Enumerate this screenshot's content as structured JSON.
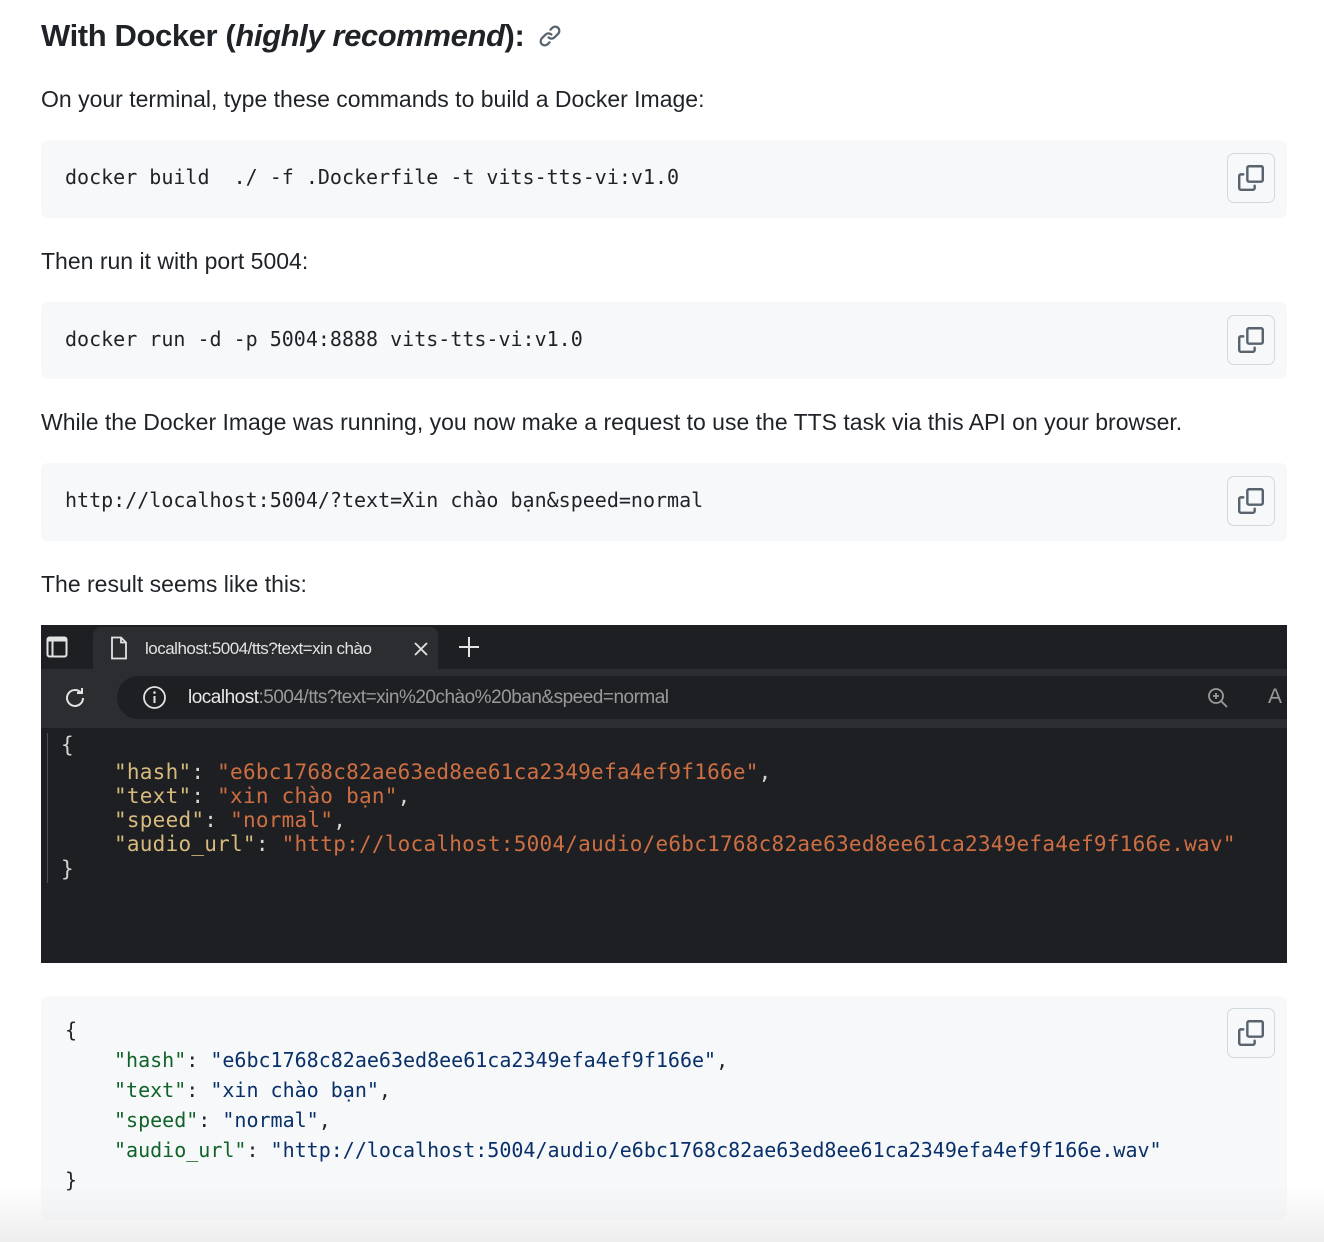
{
  "heading": {
    "prefix": "With Docker (",
    "emphasis": "highly recommend",
    "suffix": "):"
  },
  "para_build": "On your terminal, type these commands to build a Docker Image:",
  "code_build": "docker build  ./ -f .Dockerfile -t vits-tts-vi:v1.0",
  "para_run": "Then run it with port 5004:",
  "code_run": "docker run -d -p 5004:8888 vits-tts-vi:v1.0",
  "para_api": "While the Docker Image was running, you now make a request to use the TTS task via this API on your browser.",
  "code_api": "http://localhost:5004/?text=Xin chào bạn&speed=normal",
  "para_result": "The result seems like this:",
  "screenshot": {
    "tab_title": "localhost:5004/tts?text=xin chào",
    "address_host": "localhost",
    "address_rest": ":5004/tts?text=xin%20chào%20ban&speed=normal",
    "json": {
      "open": "{",
      "close": "}",
      "hash_key": "\"hash\"",
      "hash_val": "\"e6bc1768c82ae63ed8ee61ca2349efa4ef9f166e\"",
      "text_key": "\"text\"",
      "text_val": "\"xin chào bạn\"",
      "speed_key": "\"speed\"",
      "speed_val": "\"normal\"",
      "audio_key": "\"audio_url\"",
      "audio_val": "\"http://localhost:5004/audio/e6bc1768c82ae63ed8ee61ca2349efa4ef9f166e.wav\""
    }
  },
  "result_json": {
    "open": "{",
    "close": "}",
    "hash_key": "\"hash\"",
    "hash_val": "\"e6bc1768c82ae63ed8ee61ca2349efa4ef9f166e\"",
    "text_key": "\"text\"",
    "text_val": "\"xin chào bạn\"",
    "speed_key": "\"speed\"",
    "speed_val": "\"normal\"",
    "audio_key": "\"audio_url\"",
    "audio_val": "\"http://localhost:5004/audio/e6bc1768c82ae63ed8ee61ca2349efa4ef9f166e.wav\""
  },
  "punct": {
    "colon": ": ",
    "comma": ","
  },
  "icons": {
    "anchor": "link-icon",
    "copy": "copy-icon"
  },
  "colors": {
    "code_bg": "#f6f8fa",
    "link_icon": "#59636e",
    "json_key": "#116329",
    "json_string": "#0a3069"
  }
}
